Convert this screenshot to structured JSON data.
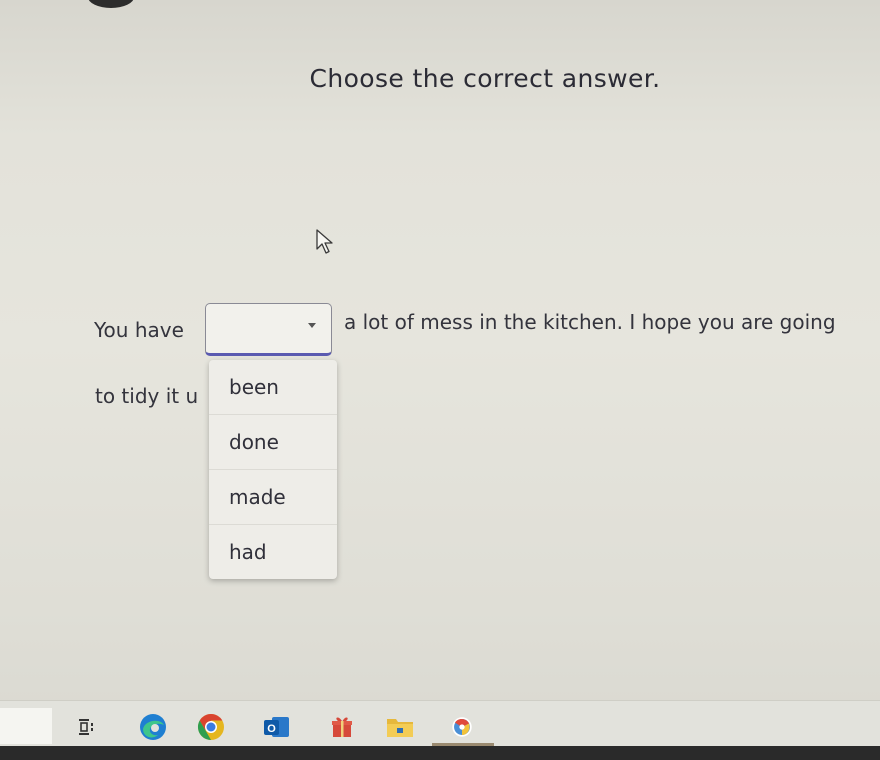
{
  "question": {
    "title": "Choose the correct answer.",
    "sentence_before": "You have",
    "sentence_after": "a lot of mess in the kitchen. I hope you are going",
    "sentence_line2": "to tidy it u",
    "selected_value": ""
  },
  "dropdown": {
    "options": [
      "been",
      "done",
      "made",
      "had"
    ]
  },
  "taskbar": {
    "icons": [
      "task-view-icon",
      "edge-icon",
      "chrome-icon",
      "outlook-icon",
      "gift-icon",
      "folder-icon",
      "app-icon"
    ],
    "outlook_letter": "O"
  },
  "colors": {
    "select_accent": "#5a5ab0",
    "background": "#e3e2da"
  }
}
